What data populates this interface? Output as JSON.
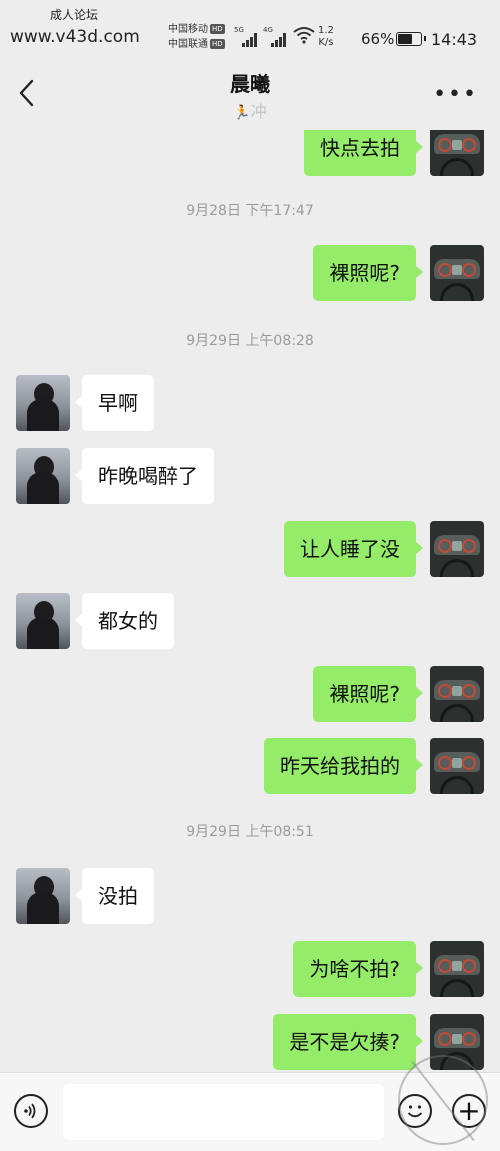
{
  "status_bar": {
    "watermark_title": "成人论坛",
    "watermark_url": "www.v43d.com",
    "carrier_1": "中国移动",
    "carrier_2": "中国联通",
    "hd_label": "HD",
    "net_1": "5G",
    "net_2": "4G",
    "speed_value": "1.2",
    "speed_unit": "K/s",
    "battery_level": "66%",
    "battery_fraction": 0.66,
    "time": "14:43"
  },
  "header": {
    "title": "晨曦",
    "subtitle": "冲",
    "back_icon": "chevron-left-icon",
    "more_icon": "more-icon"
  },
  "messages": [
    {
      "type": "out",
      "text": "快点去拍"
    },
    {
      "type": "time",
      "text": "9月28日 下午17:47"
    },
    {
      "type": "out",
      "text": "裸照呢?"
    },
    {
      "type": "time",
      "text": "9月29日 上午08:28"
    },
    {
      "type": "in",
      "text": "早啊"
    },
    {
      "type": "in",
      "text": "昨晚喝醉了"
    },
    {
      "type": "out",
      "text": "让人睡了没"
    },
    {
      "type": "in",
      "text": "都女的"
    },
    {
      "type": "out",
      "text": "裸照呢?"
    },
    {
      "type": "out",
      "text": "昨天给我拍的"
    },
    {
      "type": "time",
      "text": "9月29日 上午08:51"
    },
    {
      "type": "in",
      "text": "没拍"
    },
    {
      "type": "out",
      "text": "为啥不拍?"
    },
    {
      "type": "out",
      "text": "是不是欠揍?"
    }
  ],
  "input_bar": {
    "value": "",
    "voice_icon": "voice-icon",
    "emoji_icon": "emoji-icon",
    "plus_icon": "plus-icon"
  },
  "colors": {
    "background": "#ededed",
    "outgoing_bubble": "#95ec69",
    "incoming_bubble": "#ffffff",
    "time_text": "#9b9b9b"
  }
}
